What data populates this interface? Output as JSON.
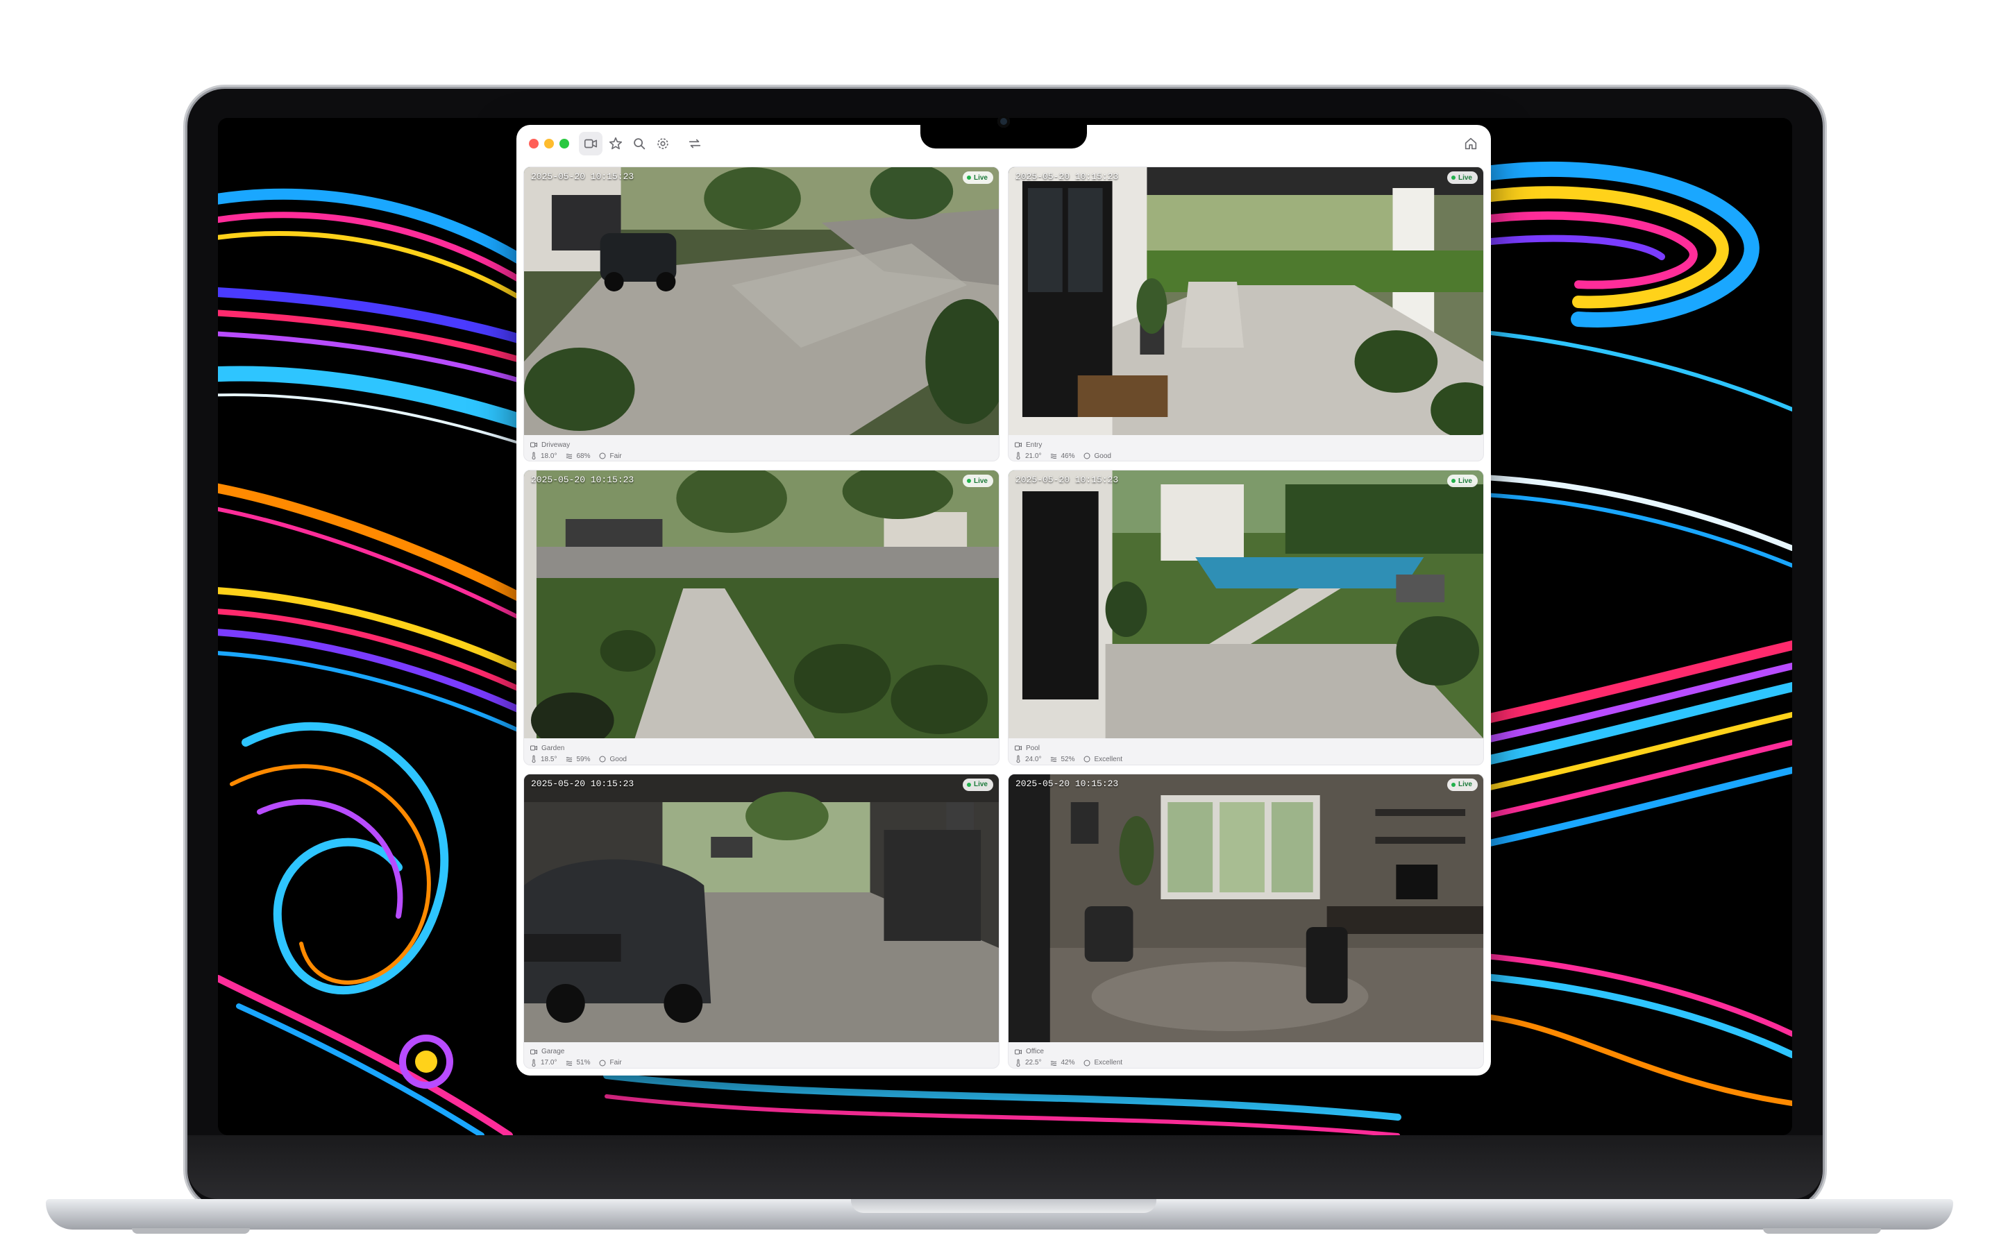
{
  "window": {
    "toolbar": [
      {
        "name": "camera-icon",
        "active": true
      },
      {
        "name": "star-icon",
        "active": false
      },
      {
        "name": "search-icon",
        "active": false
      },
      {
        "name": "gear-icon",
        "active": false
      },
      {
        "name": "switch-icon",
        "active": false
      }
    ],
    "right_icon": "home-icon"
  },
  "cameras": [
    {
      "name": "Driveway",
      "timestamp": "2025-05-20 10:15:23",
      "live": "Live",
      "temperature": "18.0°",
      "humidity": "68%",
      "quality": "Fair",
      "scene": "driveway"
    },
    {
      "name": "Entry",
      "timestamp": "2025-05-20 10:15:23",
      "live": "Live",
      "temperature": "21.0°",
      "humidity": "46%",
      "quality": "Good",
      "scene": "entry"
    },
    {
      "name": "Garden",
      "timestamp": "2025-05-20 10:15:23",
      "live": "Live",
      "temperature": "18.5°",
      "humidity": "59%",
      "quality": "Good",
      "scene": "garden"
    },
    {
      "name": "Pool",
      "timestamp": "2025-05-20 10:15:23",
      "live": "Live",
      "temperature": "24.0°",
      "humidity": "52%",
      "quality": "Excellent",
      "scene": "pool"
    },
    {
      "name": "Garage",
      "timestamp": "2025-05-20 10:15:23",
      "live": "Live",
      "temperature": "17.0°",
      "humidity": "51%",
      "quality": "Fair",
      "scene": "garage"
    },
    {
      "name": "Office",
      "timestamp": "2025-05-20 10:15:23",
      "live": "Live",
      "temperature": "22.5°",
      "humidity": "42%",
      "quality": "Excellent",
      "scene": "office"
    }
  ],
  "colors": {
    "live_dot": "#22b14c",
    "traffic_red": "#ff5f57",
    "traffic_yellow": "#febc2e",
    "traffic_green": "#28c840"
  }
}
